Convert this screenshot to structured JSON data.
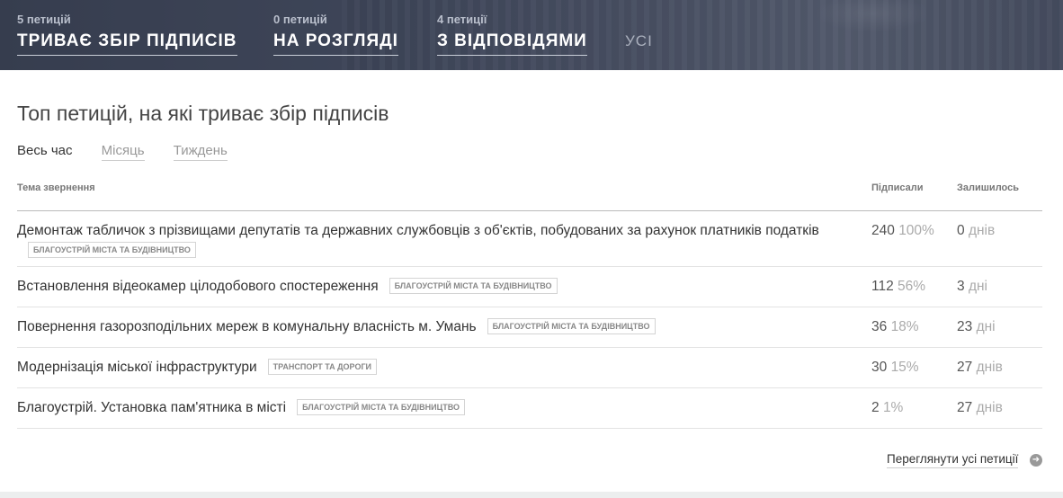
{
  "tabs": [
    {
      "count": "5 петицій",
      "label": "ТРИВАЄ ЗБІР ПІДПИСІВ"
    },
    {
      "count": "0 петицій",
      "label": "НА РОЗГЛЯДІ"
    },
    {
      "count": "4 петиції",
      "label": "З ВІДПОВІДЯМИ"
    },
    {
      "count": "",
      "label": "УСІ"
    }
  ],
  "main": {
    "title": "Топ петицій, на які триває збір підписів",
    "filters": [
      "Весь час",
      "Місяць",
      "Тиждень"
    ]
  },
  "table": {
    "headers": {
      "topic": "Тема звернення",
      "signed": "Підписали",
      "remaining": "Залишилось"
    },
    "rows": [
      {
        "topic": "Демонтаж табличок з прізвищами депутатів та державних службовців з об'єктів, побудованих за рахунок платників податків",
        "tag": "БЛАГОУСТРІЙ МІСТА ТА БУДІВНИЦТВО",
        "signed": "240",
        "pct": "100%",
        "days": "0",
        "unit": "днів"
      },
      {
        "topic": "Встановлення відеокамер цілодобового спостереження",
        "tag": "БЛАГОУСТРІЙ МІСТА ТА БУДІВНИЦТВО",
        "signed": "112",
        "pct": "56%",
        "days": "3",
        "unit": "дні"
      },
      {
        "topic": "Повернення газорозподільних мереж в комунальну власність м. Умань",
        "tag": "БЛАГОУСТРІЙ МІСТА ТА БУДІВНИЦТВО",
        "signed": "36",
        "pct": "18%",
        "days": "23",
        "unit": "дні"
      },
      {
        "topic": "Модернізація міської інфраструктури",
        "tag": "ТРАНСПОРТ ТА ДОРОГИ",
        "signed": "30",
        "pct": "15%",
        "days": "27",
        "unit": "днів"
      },
      {
        "topic": "Благоустрій. Установка пам'ятника в місті",
        "tag": "БЛАГОУСТРІЙ МІСТА ТА БУДІВНИЦТВО",
        "signed": "2",
        "pct": "1%",
        "days": "27",
        "unit": "днів"
      }
    ]
  },
  "view_all": "Переглянути усі петиції",
  "icons": {
    "view_all_icon": "arrow-right-circle-icon"
  }
}
